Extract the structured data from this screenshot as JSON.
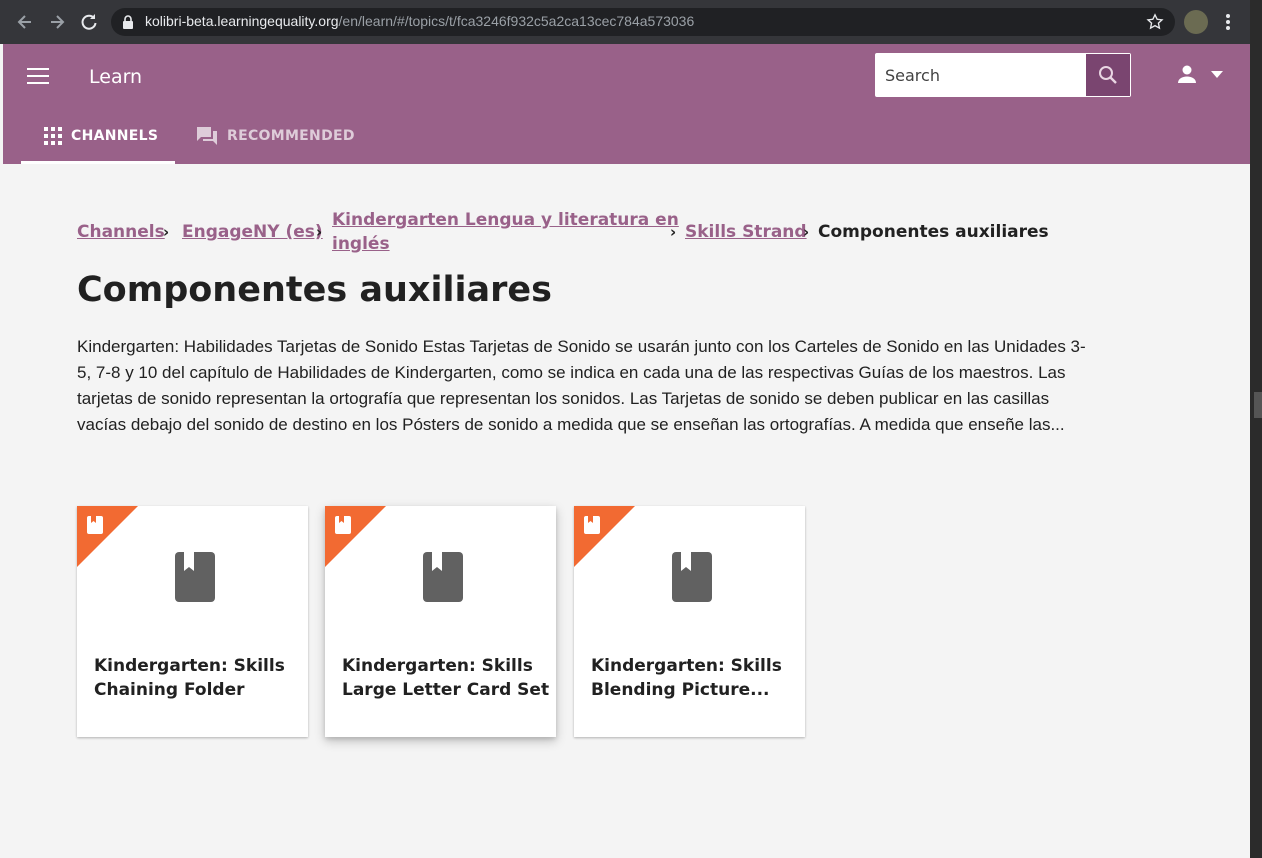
{
  "browser": {
    "url_host": "kolibri-beta.learningequality.org",
    "url_path": "/en/learn/#/topics/t/fca3246f932c5a2ca13cec784a573036"
  },
  "appbar": {
    "title": "Learn",
    "search_placeholder": "Search",
    "background": "#996189",
    "tabs": [
      {
        "label": "CHANNELS",
        "active": true,
        "icon": "apps-grid-icon"
      },
      {
        "label": "RECOMMENDED",
        "active": false,
        "icon": "forum-icon"
      }
    ]
  },
  "breadcrumb": {
    "items": [
      "Channels",
      "EngageNY (es)",
      "Kindergarten Lengua y literatura en inglés",
      "Skills Strand"
    ],
    "item3_line1": "Kindergarten Lengua y literatura en",
    "item3_line2": "inglés",
    "current": "Componentes auxiliares",
    "separator": "›"
  },
  "page": {
    "title": "Componentes auxiliares",
    "description_lines": [
      "Kindergarten: Habilidades Tarjetas de Sonido Estas Tarjetas de Sonido se usarán junto con los Carteles de Sonido en las Unidades 3-",
      "5, 7-8 y 10 del capítulo de Habilidades de Kindergarten, como se indica en cada una de las respectivas Guías de los maestros. Las",
      "tarjetas de sonido representan la ortografía que representan los sonidos. Las Tarjetas de sonido se deben publicar en las casillas",
      "vacías debajo del sonido de destino en los Pósters de sonido a medida que se enseñan las ortografías. A medida que enseñe las..."
    ]
  },
  "cards": [
    {
      "title_line1": "Kindergarten: Skills",
      "title_line2": "Chaining Folder",
      "kind": "document",
      "icon": "book-icon"
    },
    {
      "title_line1": "Kindergarten: Skills",
      "title_line2": "Large Letter Card Set",
      "kind": "document",
      "icon": "book-icon"
    },
    {
      "title_line1": "Kindergarten: Skills",
      "title_line2": "Blending Picture...",
      "kind": "document",
      "icon": "book-icon"
    }
  ],
  "colors": {
    "ribbon": "#f26a32",
    "link": "#996189",
    "icon": "#616161"
  }
}
